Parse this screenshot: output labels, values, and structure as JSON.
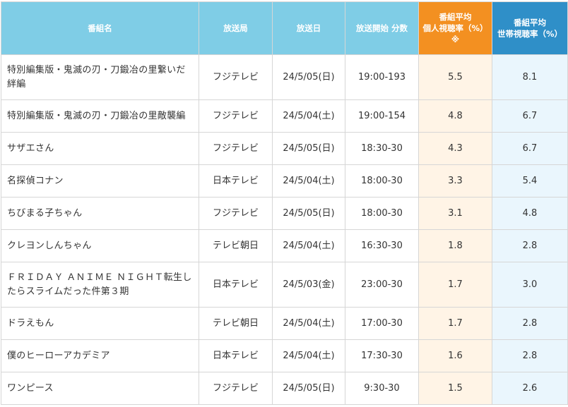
{
  "table": {
    "headers": {
      "title": "番組名",
      "station": "放送局",
      "date": "放送日",
      "time": "放送開始 分数",
      "viewer_line1": "番組平均",
      "viewer_line2": "個人視聴率（%）",
      "viewer_line3": "※",
      "household_line1": "番組平均",
      "household_line2": "世帯視聴率（%）"
    },
    "rows": [
      {
        "title": "特別編集版・鬼滅の刃・刀鍛冶の里繋いだ絆編",
        "station": "フジテレビ",
        "date": "24/5/05(日)",
        "time": "19:00-193",
        "viewer": "5.5",
        "household": "8.1"
      },
      {
        "title": "特別編集版・鬼滅の刃・刀鍛冶の里敵襲編",
        "station": "フジテレビ",
        "date": "24/5/04(土)",
        "time": "19:00-154",
        "viewer": "4.8",
        "household": "6.7"
      },
      {
        "title": "サザエさん",
        "station": "フジテレビ",
        "date": "24/5/05(日)",
        "time": "18:30-30",
        "viewer": "4.3",
        "household": "6.7"
      },
      {
        "title": "名探偵コナン",
        "station": "日本テレビ",
        "date": "24/5/04(土)",
        "time": "18:00-30",
        "viewer": "3.3",
        "household": "5.4"
      },
      {
        "title": "ちびまる子ちゃん",
        "station": "フジテレビ",
        "date": "24/5/05(日)",
        "time": "18:00-30",
        "viewer": "3.1",
        "household": "4.8"
      },
      {
        "title": "クレヨンしんちゃん",
        "station": "テレビ朝日",
        "date": "24/5/04(土)",
        "time": "16:30-30",
        "viewer": "1.8",
        "household": "2.8"
      },
      {
        "title": "ＦＲＩＤＡＹ ＡＮＩＭＥ ＮＩＧＨＴ転生したらスライムだった件第３期",
        "station": "日本テレビ",
        "date": "24/5/03(金)",
        "time": "23:00-30",
        "viewer": "1.7",
        "household": "3.0"
      },
      {
        "title": "ドラえもん",
        "station": "テレビ朝日",
        "date": "24/5/04(土)",
        "time": "17:00-30",
        "viewer": "1.7",
        "household": "2.8"
      },
      {
        "title": "僕のヒーローアカデミア",
        "station": "日本テレビ",
        "date": "24/5/04(土)",
        "time": "17:30-30",
        "viewer": "1.6",
        "household": "2.8"
      },
      {
        "title": "ワンピース",
        "station": "フジテレビ",
        "date": "24/5/05(日)",
        "time": "9:30-30",
        "viewer": "1.5",
        "household": "2.6"
      }
    ]
  },
  "colors": {
    "header_bg": "#7fcde6",
    "viewer_header_bg": "#f39021",
    "household_header_bg": "#2f8fc8",
    "viewer_cell_bg": "#fff4e6",
    "household_cell_bg": "#eaf6fd"
  }
}
